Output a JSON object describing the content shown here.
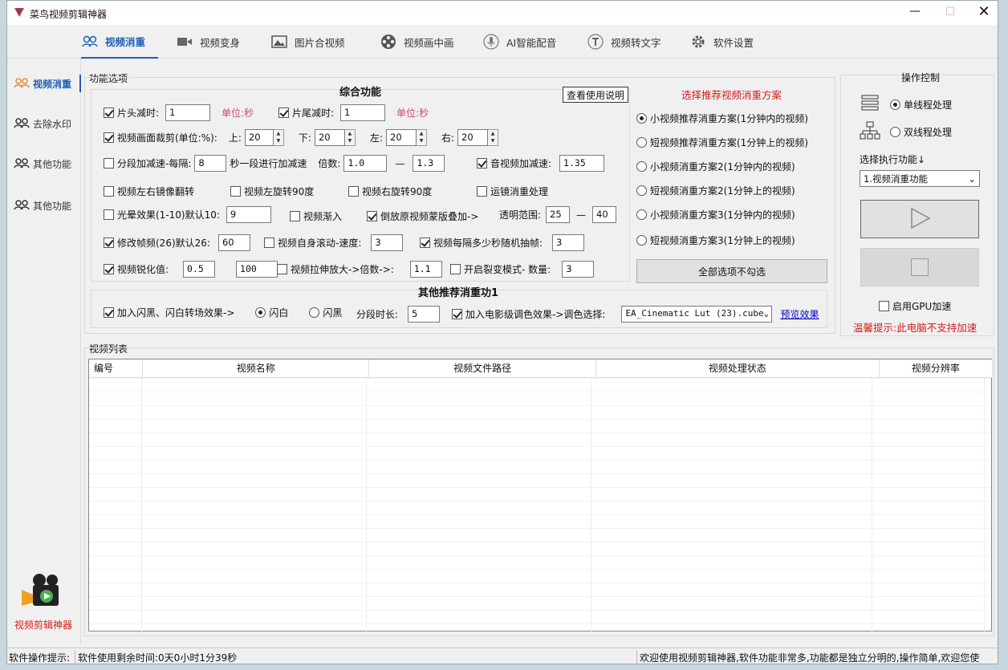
{
  "app": {
    "title": "菜鸟视频剪辑神器",
    "brand_color": "#1e5fb4",
    "logo_label": "视频剪辑神器"
  },
  "tabs": [
    {
      "label": "视频消重",
      "icon": "people-icon"
    },
    {
      "label": "视频变身",
      "icon": "camera-icon"
    },
    {
      "label": "图片合视频",
      "icon": "image-icon"
    },
    {
      "label": "视频画中画",
      "icon": "film-reel-icon"
    },
    {
      "label": "AI智能配音",
      "icon": "microphone-icon"
    },
    {
      "label": "视频转文字",
      "icon": "text-t-icon"
    },
    {
      "label": "软件设置",
      "icon": "gear-icon"
    }
  ],
  "sidebar": {
    "items": [
      {
        "label": "视频消重"
      },
      {
        "label": "去除水印"
      },
      {
        "label": "其他功能"
      },
      {
        "label": "其他功能"
      }
    ]
  },
  "options": {
    "group_title": "功能选项",
    "section_title": "综合功能",
    "help_button": "查看使用说明",
    "head_trim_label": "片头减时:",
    "head_trim_value": "1",
    "unit_sec": "单位:秒",
    "tail_trim_label": "片尾减时:",
    "tail_trim_value": "1",
    "crop_label": "视频画面裁剪(单位:%):",
    "crop_top_label": "上:",
    "crop_top": "20",
    "crop_bottom_label": "下:",
    "crop_bottom": "20",
    "crop_left_label": "左:",
    "crop_left": "20",
    "crop_right_label": "右:",
    "crop_right": "20",
    "seg_speed_label": "分段加减速-每隔:",
    "seg_speed_value": "8",
    "seg_speed_suffix": "秒一段进行加减速",
    "multiplier_label": "倍数:",
    "multiplier_min": "1.0",
    "dash": "—",
    "multiplier_max": "1.3",
    "av_speed_label": "音视频加减速:",
    "av_speed_value": "1.35",
    "mirror_label": "视频左右镜像翻转",
    "rotate_left_label": "视频左旋转90度",
    "rotate_right_label": "视频右旋转90度",
    "motion_label": "运镜消重处理",
    "halo_label": "光晕效果(1-10)默认10:",
    "halo_value": "9",
    "fade_in_label": "视频渐入",
    "reverse_mask_label": "倒放原视频蒙版叠加->",
    "opacity_label": "透明范围:",
    "opacity_min": "25",
    "opacity_max": "40",
    "fps_label": "修改帧频(26)默认26:",
    "fps_value": "60",
    "scroll_label": "视频自身滚动-速度:",
    "scroll_value": "3",
    "random_drop_label": "视频每隔多少秒随机抽帧:",
    "random_drop_value": "3",
    "sharpen_label": "视频锐化值:",
    "sharpen_value": "0.5",
    "sharpen_value2": "100",
    "stretch_label": "视频拉伸放大->倍数->:",
    "stretch_value": "1.1",
    "split_label": "开启裂变模式- 数量:",
    "split_value": "3",
    "other_title": "其他推荐消重功1",
    "flash_label": "加入闪黑、闪白转场效果->",
    "flash_white": "闪白",
    "flash_black": "闪黑",
    "seg_duration_label": "分段时长:",
    "seg_duration_value": "5",
    "lut_label": "加入电影级调色效果->调色选择:",
    "lut_value": "EA_Cinematic Lut (23).cube",
    "preview_link": "预览效果"
  },
  "schemes": {
    "title": "选择推荐视频消重方案",
    "items": [
      {
        "label": "小视频推荐消重方案(1分钟内的视频)",
        "selected": true
      },
      {
        "label": "短视频推荐消重方案(1分钟上的视频)",
        "selected": false
      },
      {
        "label": "小视频消重方案2(1分钟内的视频)",
        "selected": false
      },
      {
        "label": "短视频消重方案2(1分钟上的视频)",
        "selected": false
      },
      {
        "label": "小视频消重方案3(1分钟内的视频)",
        "selected": false
      },
      {
        "label": "短视频消重方案3(1分钟上的视频)",
        "selected": false
      }
    ],
    "uncheck_all": "全部选项不勾选"
  },
  "control": {
    "title": "操作控制",
    "single": "单线程处理",
    "multi": "双线程处理",
    "select_label": "选择执行功能↓",
    "select_value": "1.视频消重功能",
    "gpu_label": "启用GPU加速",
    "warning": "温馨提示:此电脑不支持加速"
  },
  "list": {
    "title": "视频列表",
    "columns": [
      "编号",
      "视频名称",
      "视频文件路径",
      "视频处理状态",
      "视频分辨率"
    ]
  },
  "status": {
    "hint_label": "软件操作提示:",
    "remaining": "软件使用剩余时间:0天0小时1分39秒",
    "welcome": "欢迎使用视频剪辑神器,软件功能非常多,功能都是独立分明的,操作简单,欢迎您使"
  }
}
